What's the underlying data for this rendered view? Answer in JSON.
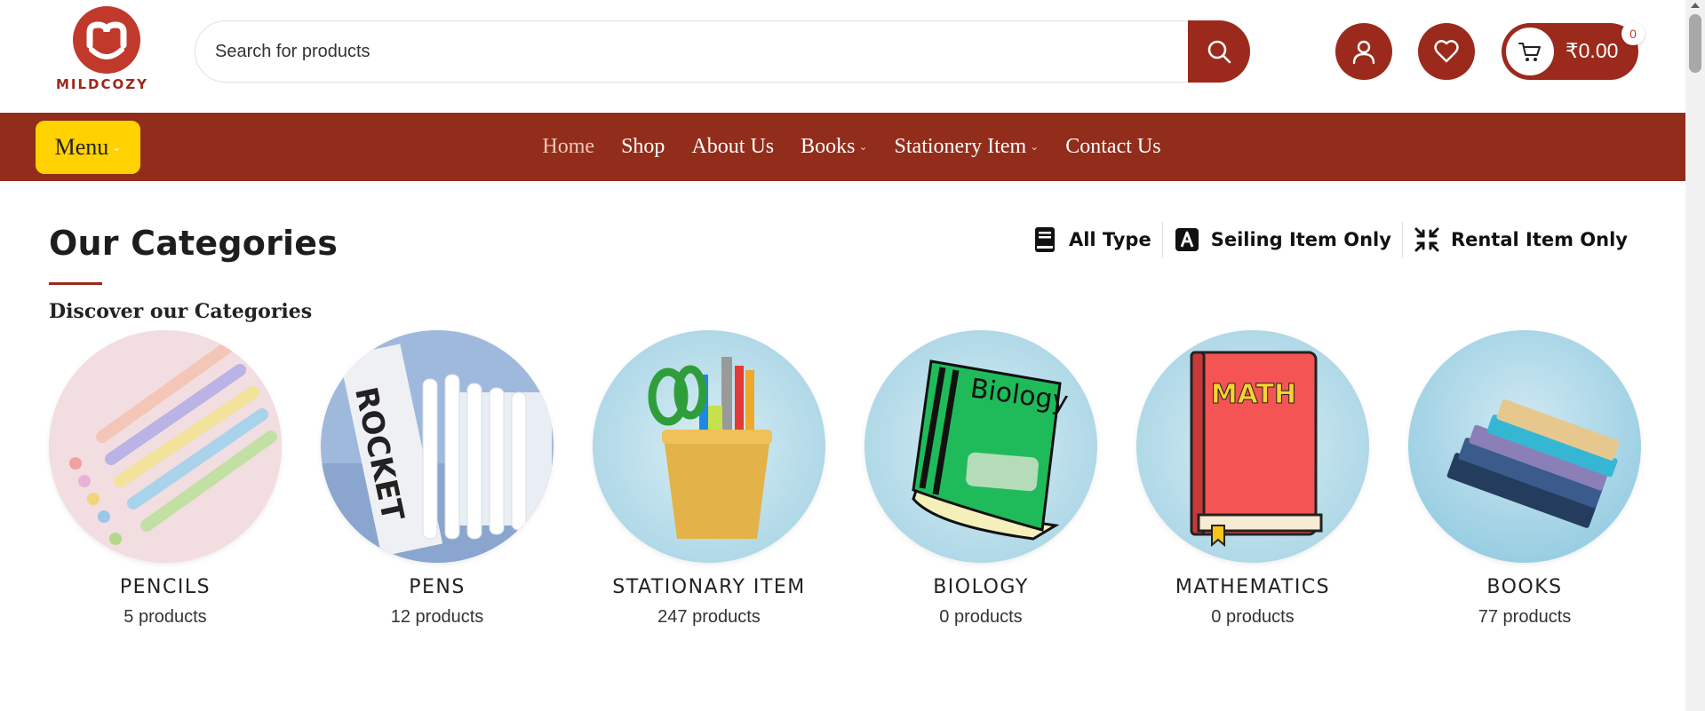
{
  "brand": {
    "name": "MILDCOZY",
    "color": "#9b2a1c"
  },
  "header": {
    "search": {
      "placeholder": "Search for products"
    },
    "cart": {
      "amount": "₹0.00",
      "count": "0"
    }
  },
  "nav": {
    "menu_label": "Menu",
    "links": [
      {
        "label": "Home",
        "active": true
      },
      {
        "label": "Shop"
      },
      {
        "label": "About Us"
      },
      {
        "label": "Books",
        "dropdown": true
      },
      {
        "label": "Stationery Item",
        "dropdown": true
      },
      {
        "label": "Contact Us"
      }
    ],
    "bg_color": "#922d1b",
    "menu_color": "#ffd200"
  },
  "section": {
    "title": "Our Categories",
    "subtitle": "Discover our Categories",
    "filters": [
      {
        "label": "All Type",
        "icon": "book-icon"
      },
      {
        "label": "Seiling Item Only",
        "icon": "letter-a-icon"
      },
      {
        "label": "Rental Item Only",
        "icon": "compress-icon"
      }
    ]
  },
  "categories": [
    {
      "name": "PENCILS",
      "count": "5 products"
    },
    {
      "name": "PENS",
      "count": "12 products"
    },
    {
      "name": "STATIONARY ITEM",
      "count": "247 products"
    },
    {
      "name": "BIOLOGY",
      "count": "0 products"
    },
    {
      "name": "MATHEMATICS",
      "count": "0 products"
    },
    {
      "name": "BOOKS",
      "count": "77 products"
    }
  ],
  "category_images": {
    "biology_book_text": "Biology",
    "math_book_text": "MATH",
    "pen_box_text": "ROCKET"
  }
}
